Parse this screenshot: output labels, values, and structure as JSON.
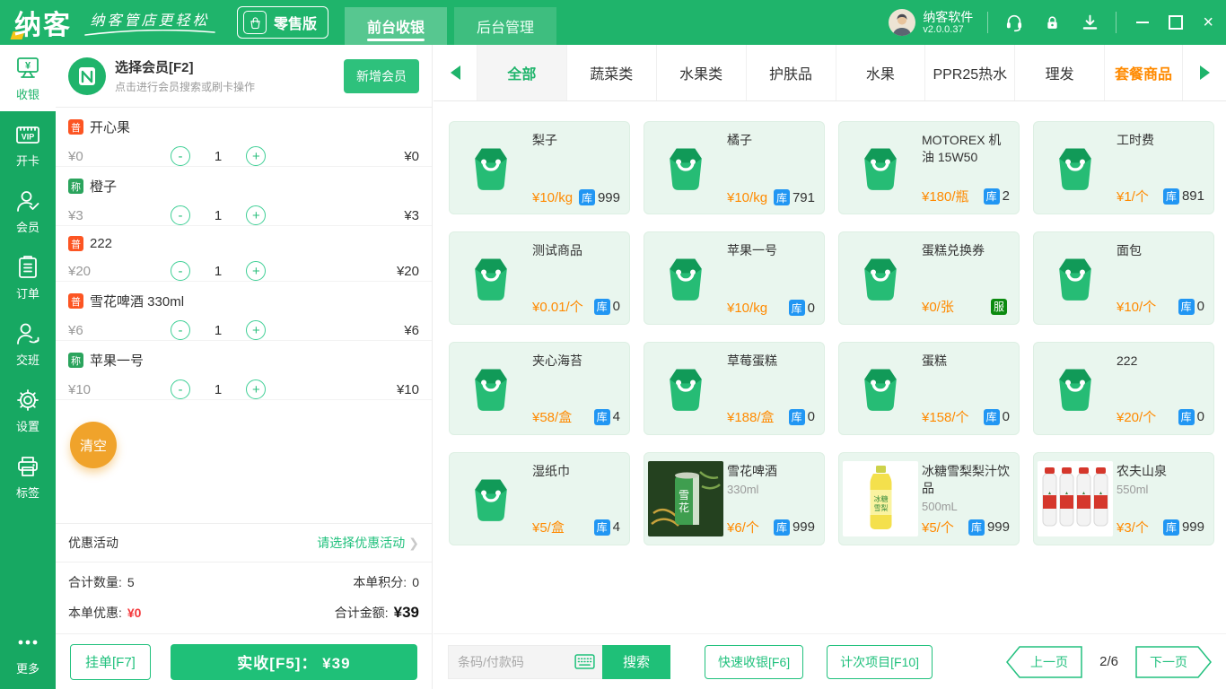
{
  "colors": {
    "header_green": "#1FB46B",
    "sidebar_green": "#17A862",
    "accent_green": "#21C17D",
    "price_orange": "#FF8A00",
    "stock_badge_blue": "#2196F3",
    "service_badge_green": "#0B8A0F",
    "normal_badge_orange": "#FC5523",
    "weigh_badge_green": "#2BA45D",
    "clear_button_orange": "#F0A32B",
    "discount_red": "#F4393C",
    "highlight_tab_orange": "#FF8A00"
  },
  "header": {
    "logo_text": "纳客",
    "slogan": "纳客管店更轻松",
    "edition_badge": "零售版",
    "tabs": [
      {
        "id": "front-cashier",
        "label": "前台收银",
        "active": true
      },
      {
        "id": "back-admin",
        "label": "后台管理",
        "active": false
      }
    ],
    "user": {
      "name": "纳客软件",
      "version": "v2.0.0.37"
    },
    "icon_names": [
      "customer-service-icon",
      "lock-icon",
      "download-icon",
      "minimize-icon",
      "maximize-icon",
      "close-icon"
    ]
  },
  "sidebar": {
    "items": [
      {
        "id": "cashier",
        "label": "收银",
        "icon": "cash-register-icon",
        "active": true
      },
      {
        "id": "open-card",
        "label": "开卡",
        "icon": "vip-card-icon",
        "active": false
      },
      {
        "id": "member",
        "label": "会员",
        "icon": "member-icon",
        "active": false
      },
      {
        "id": "orders",
        "label": "订单",
        "icon": "order-list-icon",
        "active": false
      },
      {
        "id": "shift",
        "label": "交班",
        "icon": "shift-change-icon",
        "active": false
      },
      {
        "id": "settings",
        "label": "设置",
        "icon": "settings-gear-icon",
        "active": false
      },
      {
        "id": "label-print",
        "label": "标签",
        "icon": "label-printer-icon",
        "active": false
      }
    ],
    "more": {
      "id": "more",
      "label": "更多",
      "icon": "more-dots-icon"
    }
  },
  "cart": {
    "member": {
      "title": "选择会员[F2]",
      "subtitle": "点击进行会员搜索或刷卡操作",
      "add_button": "新增会员"
    },
    "items": [
      {
        "badge": "普",
        "badge_type": "normal",
        "name": "开心果",
        "price": "¥0",
        "qty": "1",
        "total": "¥0"
      },
      {
        "badge": "称",
        "badge_type": "weigh",
        "name": "橙子",
        "price": "¥3",
        "qty": "1",
        "total": "¥3"
      },
      {
        "badge": "普",
        "badge_type": "normal",
        "name": "222",
        "price": "¥20",
        "qty": "1",
        "total": "¥20"
      },
      {
        "badge": "普",
        "badge_type": "normal",
        "name": "雪花啤酒 330ml",
        "price": "¥6",
        "qty": "1",
        "total": "¥6"
      },
      {
        "badge": "称",
        "badge_type": "weigh",
        "name": "苹果一号",
        "price": "¥10",
        "qty": "1",
        "total": "¥10"
      }
    ],
    "clear_button": "清空",
    "promo": {
      "label": "优惠活动",
      "link": "请选择优惠活动",
      "chevron": "❯"
    },
    "summary": {
      "qty_label": "合计数量:",
      "qty_value": "5",
      "points_label": "本单积分:",
      "points_value": "0",
      "discount_label": "本单优惠:",
      "discount_value": "¥0",
      "total_label": "合计金额:",
      "total_value": "¥39"
    },
    "hold_button": "挂单[F7]",
    "checkout_button": "实收[F5]： ¥39"
  },
  "categories": {
    "items": [
      {
        "label": "全部",
        "state": "active"
      },
      {
        "label": "蔬菜类",
        "state": "normal"
      },
      {
        "label": "水果类",
        "state": "normal"
      },
      {
        "label": "护肤品",
        "state": "normal"
      },
      {
        "label": "水果",
        "state": "normal"
      },
      {
        "label": "PPR25热水",
        "state": "normal"
      },
      {
        "label": "理发",
        "state": "normal"
      },
      {
        "label": "套餐商品",
        "state": "highlight"
      }
    ]
  },
  "products": [
    {
      "name": "梨子",
      "subtitle": "",
      "price": "¥10/kg",
      "stock_badge": "库",
      "stock": "999",
      "image": "bag-icon"
    },
    {
      "name": "橘子",
      "subtitle": "",
      "price": "¥10/kg",
      "stock_badge": "库",
      "stock": "791",
      "image": "bag-icon"
    },
    {
      "name": "MOTOREX 机油 15W50",
      "subtitle": "",
      "price": "¥180/瓶",
      "stock_badge": "库",
      "stock": "2",
      "image": "bag-icon"
    },
    {
      "name": "工时费",
      "subtitle": "",
      "price": "¥1/个",
      "stock_badge": "库",
      "stock": "891",
      "image": "bag-icon"
    },
    {
      "name": "测试商品",
      "subtitle": "",
      "price": "¥0.01/个",
      "stock_badge": "库",
      "stock": "0",
      "image": "bag-icon"
    },
    {
      "name": "苹果一号",
      "subtitle": "",
      "price": "¥10/kg",
      "stock_badge": "库",
      "stock": "0",
      "image": "bag-icon"
    },
    {
      "name": "蛋糕兑换券",
      "subtitle": "",
      "price": "¥0/张",
      "stock_badge": "服",
      "stock": "",
      "image": "bag-icon"
    },
    {
      "name": "面包",
      "subtitle": "",
      "price": "¥10/个",
      "stock_badge": "库",
      "stock": "0",
      "image": "bag-icon"
    },
    {
      "name": "夹心海苔",
      "subtitle": "",
      "price": "¥58/盒",
      "stock_badge": "库",
      "stock": "4",
      "image": "bag-icon"
    },
    {
      "name": "草莓蛋糕",
      "subtitle": "",
      "price": "¥188/盒",
      "stock_badge": "库",
      "stock": "0",
      "image": "bag-icon"
    },
    {
      "name": "蛋糕",
      "subtitle": "",
      "price": "¥158/个",
      "stock_badge": "库",
      "stock": "0",
      "image": "bag-icon"
    },
    {
      "name": "222",
      "subtitle": "",
      "price": "¥20/个",
      "stock_badge": "库",
      "stock": "0",
      "image": "bag-icon"
    },
    {
      "name": "湿纸巾",
      "subtitle": "",
      "price": "¥5/盒",
      "stock_badge": "库",
      "stock": "4",
      "image": "bag-icon"
    },
    {
      "name": "雪花啤酒",
      "subtitle": "330ml",
      "price": "¥6/个",
      "stock_badge": "库",
      "stock": "999",
      "image": "beer-can-photo"
    },
    {
      "name": "冰糖雪梨梨汁饮品",
      "subtitle": "500mL",
      "price": "¥5/个",
      "stock_badge": "库",
      "stock": "999",
      "image": "juice-bottle-photo"
    },
    {
      "name": "农夫山泉",
      "subtitle": "550ml",
      "price": "¥3/个",
      "stock_badge": "库",
      "stock": "999",
      "image": "water-pack-photo"
    }
  ],
  "bottom_bar": {
    "search_placeholder": "条码/付款码",
    "search_button": "搜索",
    "quick_button": "快速收银[F6]",
    "count_button": "计次项目[F10]",
    "prev_button": "上一页",
    "page_indicator": "2/6",
    "next_button": "下一页"
  }
}
